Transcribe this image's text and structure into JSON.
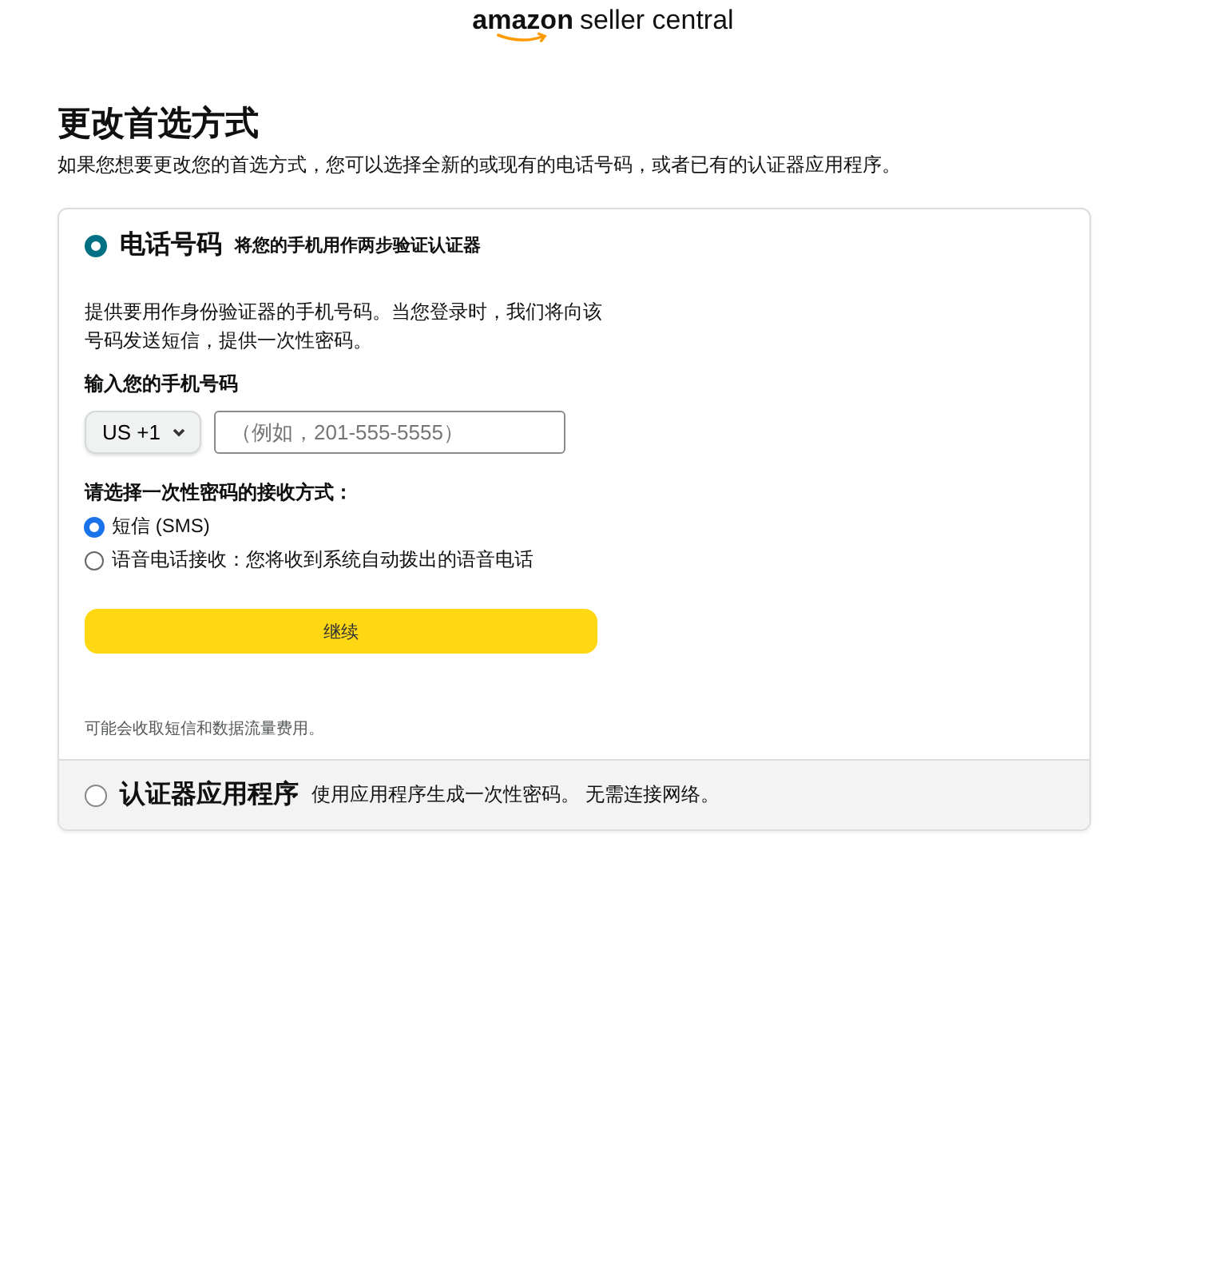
{
  "header": {
    "logo_brand": "amazon",
    "logo_product": "seller central"
  },
  "page": {
    "title": "更改首选方式",
    "subtitle": "如果您想要更改您的首选方式，您可以选择全新的或现有的电话号码，或者已有的认证器应用程序。"
  },
  "methods": [
    {
      "kind": "phone",
      "title": "电话号码",
      "subtitle": "将您的手机用作两步验证认证器",
      "selected": true,
      "details": {
        "description": "提供要用作身份验证器的手机号码。当您登录时，我们将向该号码发送短信，提供一次性密码。",
        "phone_label": "输入您的手机号码",
        "country_code": "US +1",
        "phone_placeholder": "（例如，201-555-5555）",
        "otp_label": "请选择一次性密码的接收方式：",
        "otp_options": [
          {
            "label": "短信 (SMS)",
            "selected": true
          },
          {
            "label": "语音电话接收：您将收到系统自动拨出的语音电话",
            "selected": false
          }
        ],
        "button": "继续",
        "note": "可能会收取短信和数据流量费用。"
      }
    },
    {
      "kind": "app",
      "title": "认证器应用程序",
      "subtitle": "使用应用程序生成一次性密码。 无需连接网络。",
      "selected": false
    }
  ]
}
